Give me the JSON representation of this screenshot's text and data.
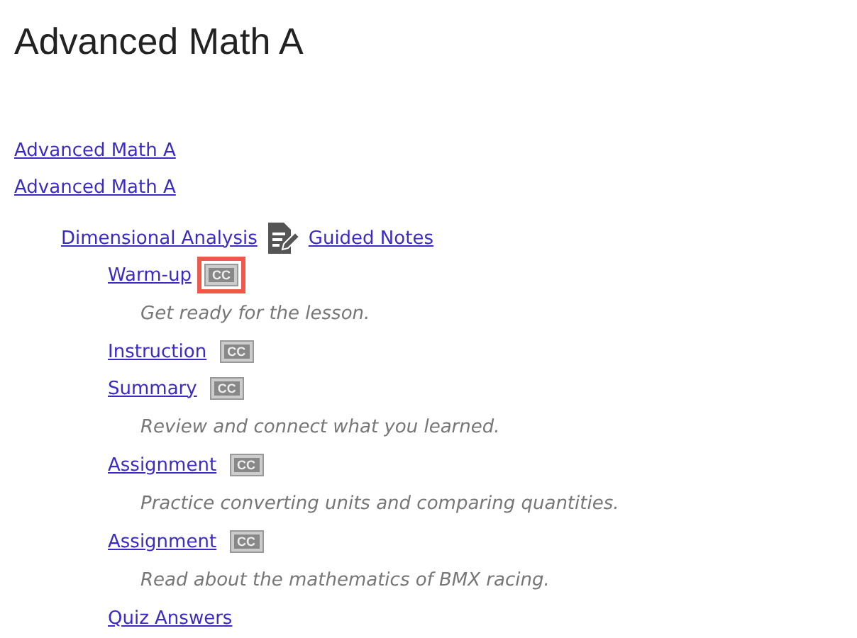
{
  "title": "Advanced Math A",
  "breadcrumbs": [
    "Advanced Math A",
    "Advanced Math A"
  ],
  "unit": {
    "label": "Dimensional Analysis",
    "notes_link": "Guided Notes",
    "items": [
      {
        "label": "Warm-up",
        "badge": "CC",
        "highlighted": true,
        "description": "Get ready for the lesson."
      },
      {
        "label": "Instruction",
        "badge": "CC",
        "highlighted": false
      },
      {
        "label": "Summary",
        "badge": "CC",
        "highlighted": false,
        "description": "Review and connect what you learned."
      },
      {
        "label": "Assignment",
        "badge": "CC",
        "highlighted": false,
        "description": "Practice converting units and comparing quantities."
      },
      {
        "label": "Assignment",
        "badge": "CC",
        "highlighted": false,
        "description": "Read about the mathematics of BMX racing."
      },
      {
        "label": "Quiz Answers"
      }
    ]
  }
}
